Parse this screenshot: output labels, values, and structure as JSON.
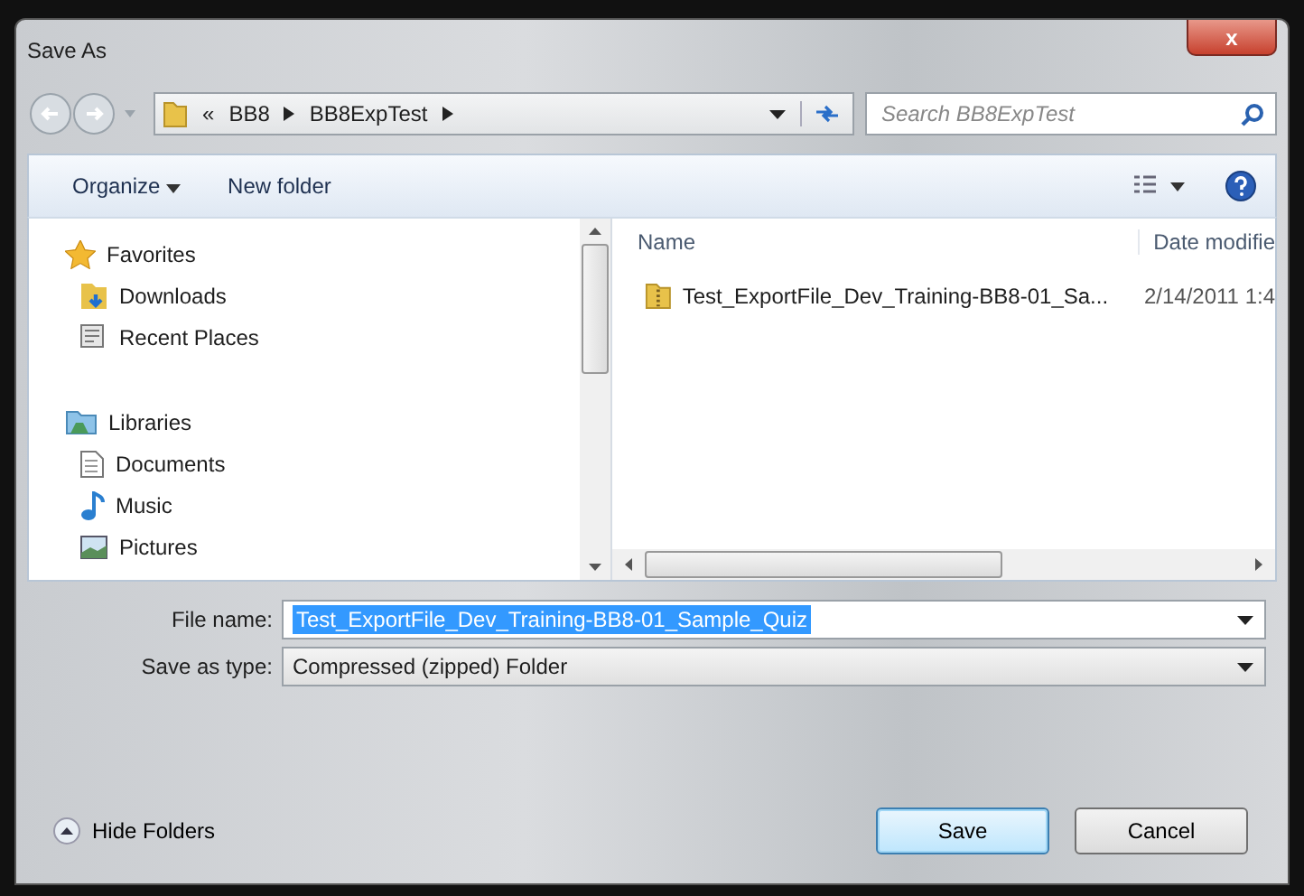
{
  "window": {
    "title": "Save As",
    "close": "x"
  },
  "address": {
    "overflow": "«",
    "crumbs": [
      "BB8",
      "BB8ExpTest"
    ]
  },
  "search": {
    "placeholder": "Search BB8ExpTest"
  },
  "toolbar": {
    "organize": "Organize",
    "new_folder": "New folder"
  },
  "sidebar": {
    "groups": [
      {
        "label": "Favorites",
        "children": [
          {
            "label": "Downloads"
          },
          {
            "label": "Recent Places"
          }
        ]
      },
      {
        "label": "Libraries",
        "children": [
          {
            "label": "Documents"
          },
          {
            "label": "Music"
          },
          {
            "label": "Pictures"
          }
        ]
      }
    ]
  },
  "files": {
    "columns": [
      "Name",
      "Date modifie"
    ],
    "rows": [
      {
        "name": "Test_ExportFile_Dev_Training-BB8-01_Sa...",
        "date": "2/14/2011 1:4",
        "selected": false
      }
    ]
  },
  "form": {
    "file_name_label": "File name:",
    "file_name": "Test_ExportFile_Dev_Training-BB8-01_Sample_Quiz",
    "type_label": "Save as type:",
    "type": "Compressed (zipped) Folder"
  },
  "footer": {
    "hide_folders": "Hide Folders",
    "buttons": [
      {
        "label": "Save",
        "default": true
      },
      {
        "label": "Cancel",
        "default": false
      }
    ]
  }
}
